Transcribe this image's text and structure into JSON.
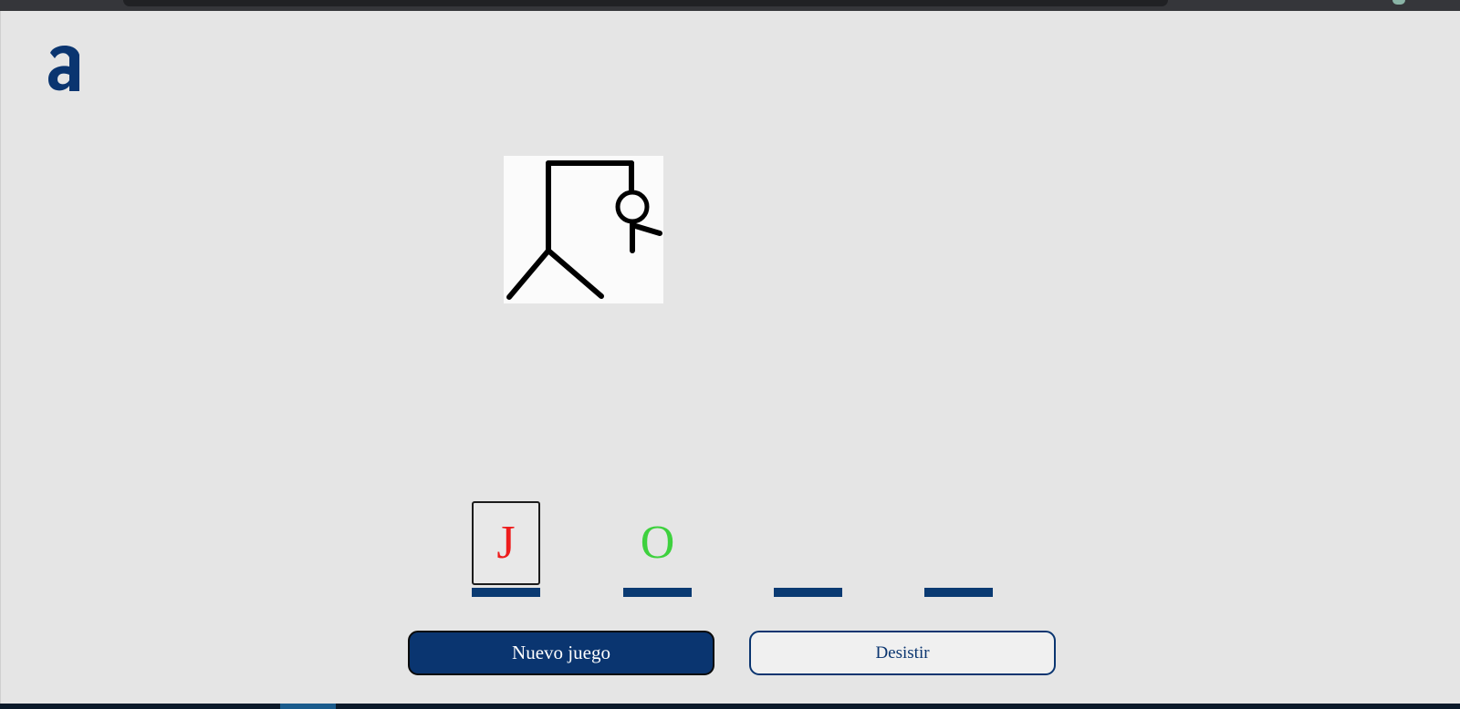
{
  "app": {
    "logo_icon": "alura-a-logo",
    "brand_color": "#0a3570"
  },
  "hangman": {
    "icon": "hangman-drawing",
    "wrong_guesses": 3
  },
  "word": {
    "letters": [
      {
        "char": "J",
        "color": "#ee1c1c",
        "focused": true
      },
      {
        "char": "O",
        "color": "#3ed13e",
        "focused": false
      },
      {
        "char": "",
        "color": "#000000",
        "focused": false
      },
      {
        "char": "",
        "color": "#000000",
        "focused": false
      }
    ]
  },
  "buttons": {
    "new_game_label": "Nuevo juego",
    "give_up_label": "Desistir"
  }
}
